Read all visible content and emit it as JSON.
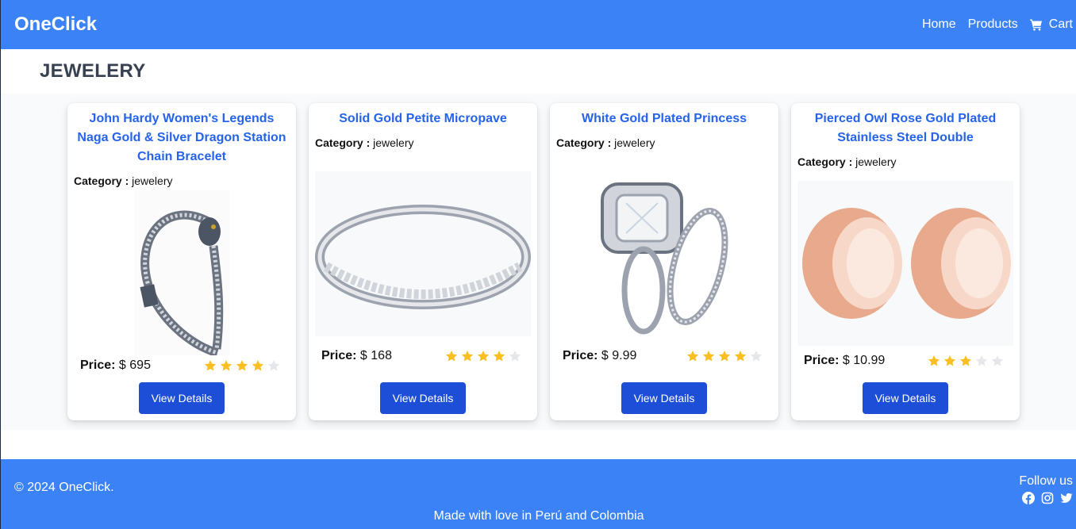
{
  "header": {
    "brand": "OneClick",
    "nav": {
      "home": "Home",
      "products": "Products",
      "cart": "Cart"
    }
  },
  "section": {
    "title": "JEWELERY"
  },
  "products": [
    {
      "title": "John Hardy Women's Legends Naga Gold & Silver Dragon Station Chain Bracelet",
      "category_label": "Category :",
      "category": "jewelery",
      "price_label": "Price:",
      "price": "$ 695",
      "rating": 4,
      "button": "View Details",
      "image": "bracelet-image"
    },
    {
      "title": "Solid Gold Petite Micropave",
      "category_label": "Category :",
      "category": "jewelery",
      "price_label": "Price:",
      "price": "$ 168",
      "rating": 4,
      "button": "View Details",
      "image": "ring-image"
    },
    {
      "title": "White Gold Plated Princess",
      "category_label": "Category :",
      "category": "jewelery",
      "price_label": "Price:",
      "price": "$ 9.99",
      "rating": 4,
      "button": "View Details",
      "image": "engagement-ring-image"
    },
    {
      "title": "Pierced Owl Rose Gold Plated Stainless Steel Double",
      "category_label": "Category :",
      "category": "jewelery",
      "price_label": "Price:",
      "price": "$ 10.99",
      "rating": 3,
      "button": "View Details",
      "image": "rose-gold-tunnels-image"
    }
  ],
  "footer": {
    "copyright": "© 2024 OneClick.",
    "follow": "Follow us",
    "made_with": "Made with love in Perú and Colombia",
    "icons": [
      "facebook-icon",
      "instagram-icon",
      "twitter-icon"
    ]
  },
  "colors": {
    "primary": "#3b82f6",
    "button": "#1d4ed8",
    "title": "#2563eb",
    "star": "#fbbf24",
    "star_empty": "#e5e7eb"
  }
}
